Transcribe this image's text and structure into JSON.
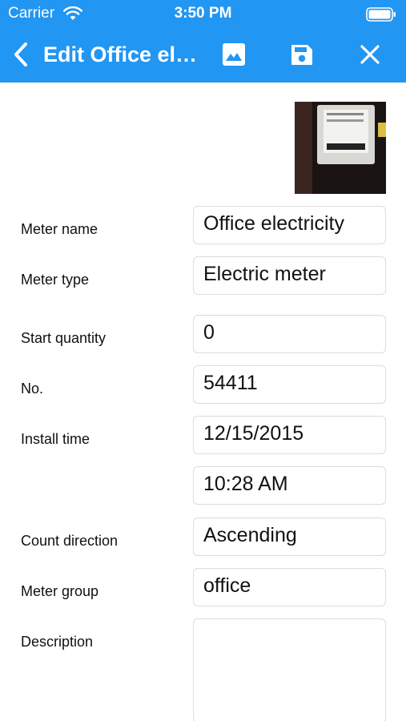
{
  "status_bar": {
    "carrier": "Carrier",
    "time": "3:50 PM"
  },
  "header": {
    "title": "Edit Office electricity",
    "background_color": "#2196F3"
  },
  "icons": {
    "back": "back-chevron-icon",
    "image": "image-icon",
    "save": "save-icon",
    "close": "close-icon"
  },
  "photo": {
    "alt": "meter-photo"
  },
  "form": {
    "meter_name": {
      "label": "Meter name",
      "value": "Office electricity"
    },
    "meter_type": {
      "label": "Meter type",
      "value": "Electric meter"
    },
    "start_quantity": {
      "label": "Start quantity",
      "value": "0"
    },
    "no": {
      "label": "No.",
      "value": "54411"
    },
    "install_time": {
      "label": "Install time",
      "date": "12/15/2015",
      "time": "10:28 AM"
    },
    "count_direction": {
      "label": "Count direction",
      "value": "Ascending"
    },
    "meter_group": {
      "label": "Meter group",
      "value": "office"
    },
    "description": {
      "label": "Description",
      "value": ""
    }
  }
}
